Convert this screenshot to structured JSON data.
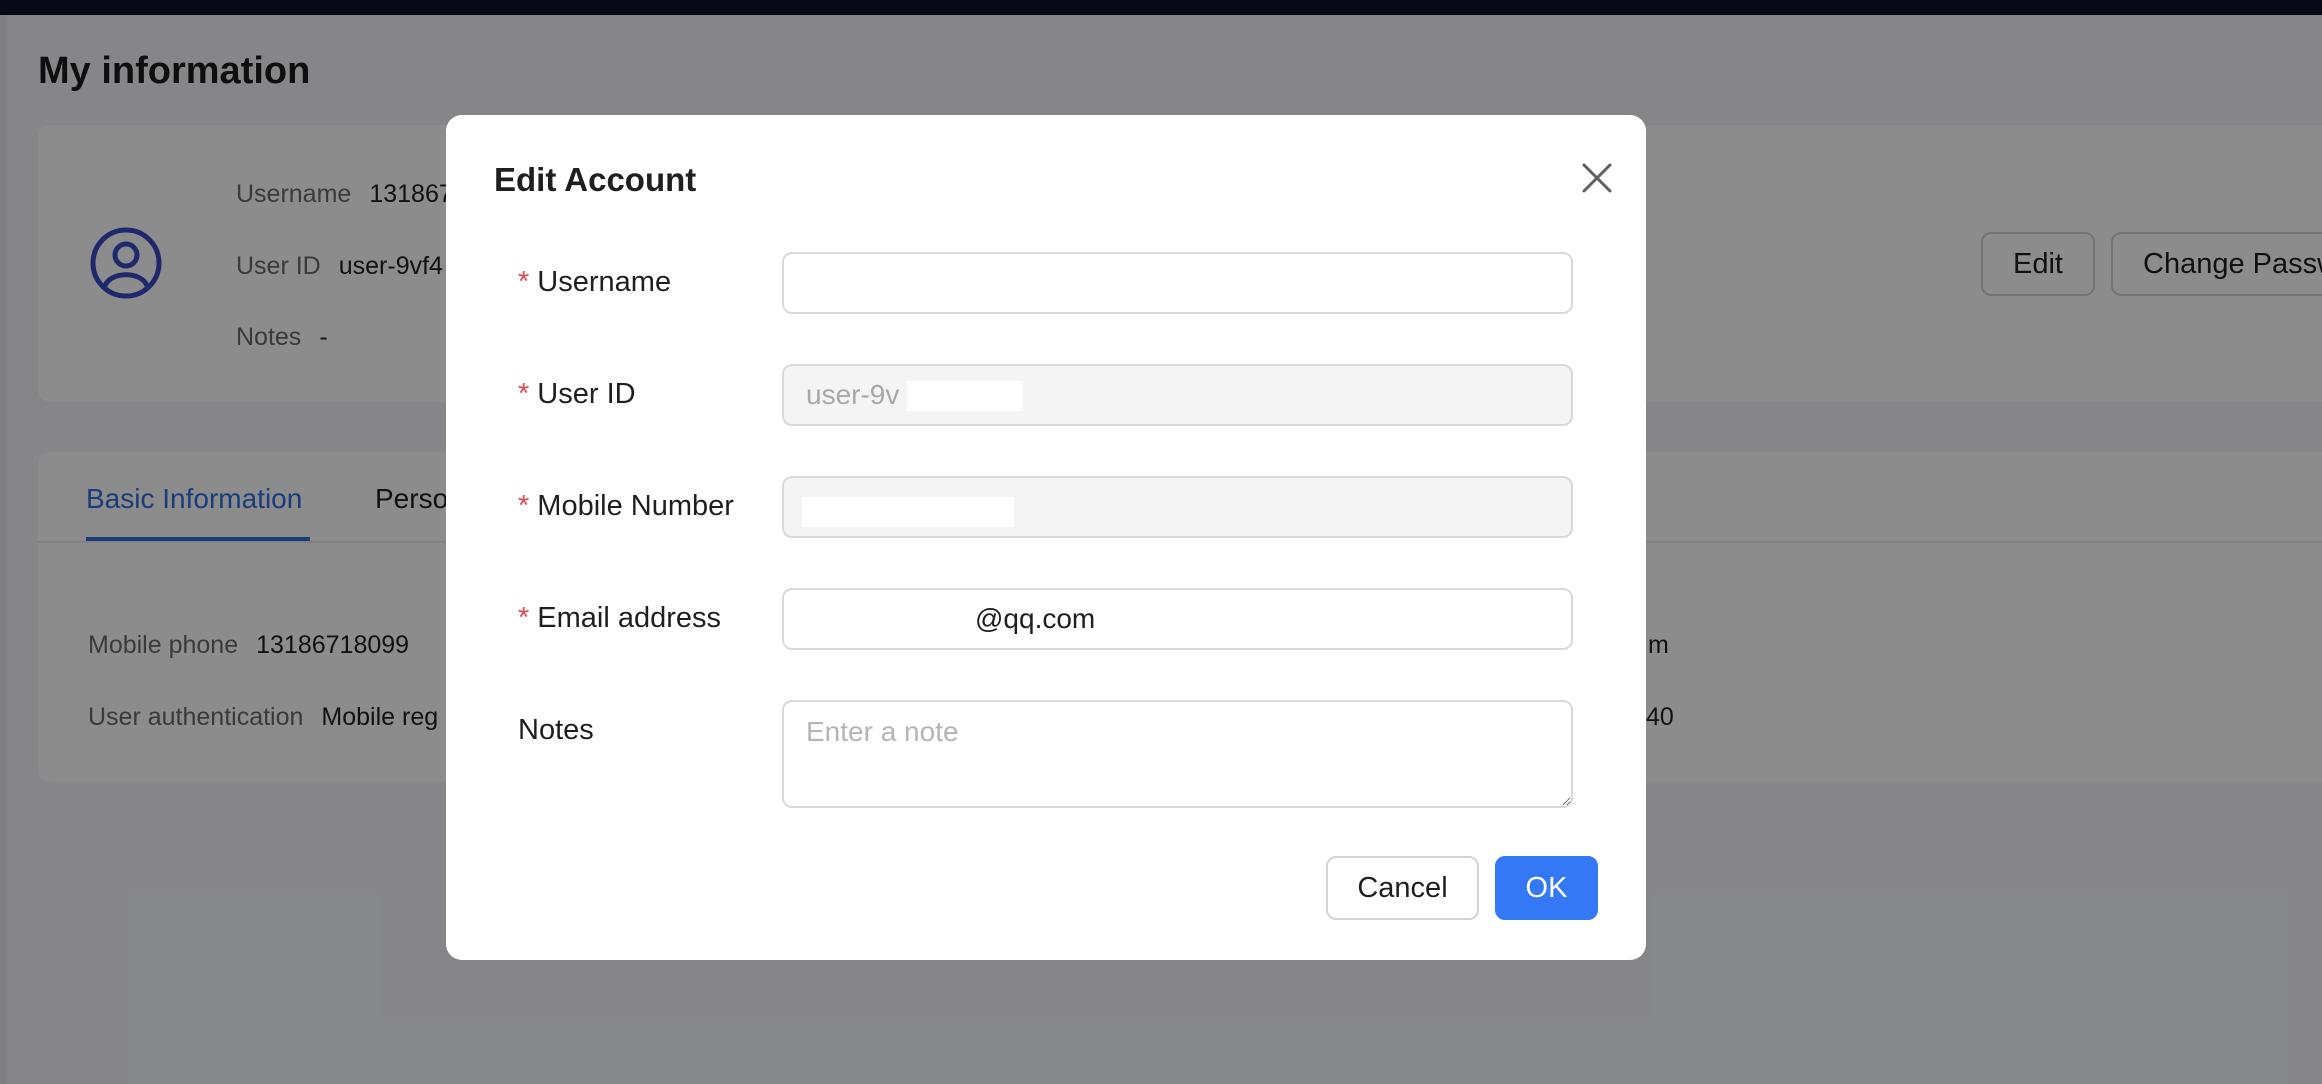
{
  "page": {
    "title": "My information"
  },
  "profile": {
    "username_label": "Username",
    "username_value": "131867",
    "user_id_label": "User ID",
    "user_id_value": "user-9vf4",
    "notes_label": "Notes",
    "notes_value": "-",
    "edit_label": "Edit",
    "change_password_label": "Change Passw"
  },
  "tabs": [
    {
      "label": "Basic Information",
      "active": true
    },
    {
      "label": "Perso",
      "active": false
    }
  ],
  "basic_info": {
    "mobile_phone_label": "Mobile phone",
    "mobile_phone_value": "13186718099",
    "user_auth_label": "User authentication",
    "user_auth_value": "Mobile reg",
    "right_fragment_1": "m",
    "right_fragment_2": "40"
  },
  "modal": {
    "title": "Edit Account",
    "fields": {
      "username": {
        "label": "Username",
        "required": true,
        "value": ""
      },
      "user_id": {
        "label": "User ID",
        "required": true,
        "value": "user-9v",
        "disabled": true
      },
      "mobile_number": {
        "label": "Mobile Number",
        "required": true,
        "value": "",
        "disabled": true
      },
      "email": {
        "label": "Email address",
        "required": true,
        "value": "@qq.com"
      },
      "notes": {
        "label": "Notes",
        "required": false,
        "value": "",
        "placeholder": "Enter a note"
      }
    },
    "required_marker": "*",
    "cancel_label": "Cancel",
    "ok_label": "OK"
  },
  "colors": {
    "accent": "#3478f6",
    "tab_active": "#2f6fe0",
    "required": "#e5484d",
    "topbar": "#0b0e2a"
  },
  "icons": {
    "avatar": "user-circle-icon",
    "close": "close-icon"
  }
}
